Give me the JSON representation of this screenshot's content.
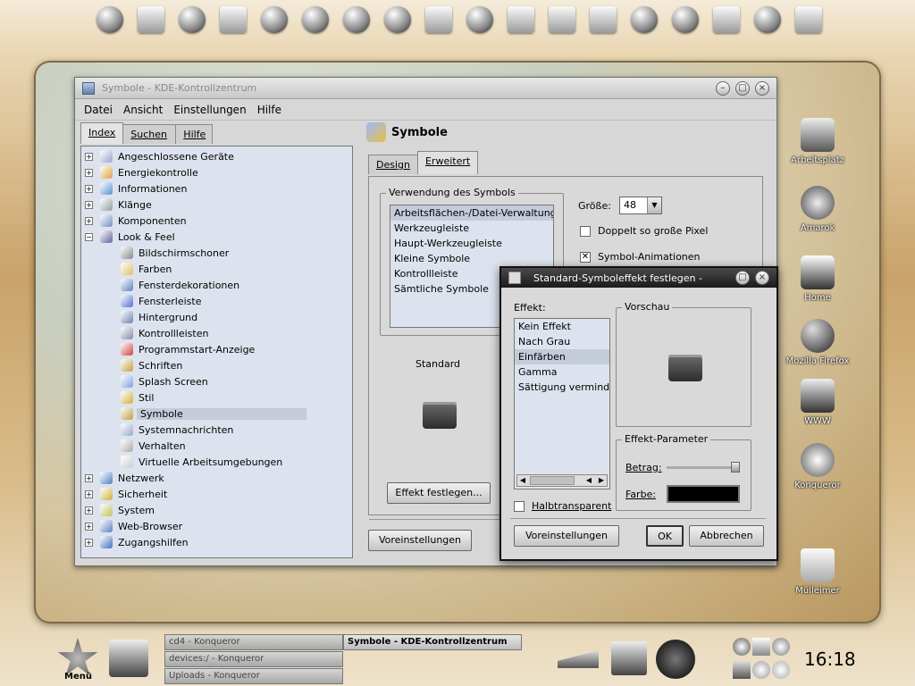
{
  "window": {
    "title": "Symbole - KDE-Kontrollzentrum",
    "menus": [
      "Datei",
      "Ansicht",
      "Einstellungen",
      "Hilfe"
    ]
  },
  "left_tabs": [
    "Index",
    "Suchen",
    "Hilfe"
  ],
  "tree": [
    {
      "label": "Angeschlossene Geräte",
      "expander": "+"
    },
    {
      "label": "Energiekontrolle",
      "expander": "+"
    },
    {
      "label": "Informationen",
      "expander": "+"
    },
    {
      "label": "Klänge",
      "expander": "+"
    },
    {
      "label": "Komponenten",
      "expander": "+"
    },
    {
      "label": "Look & Feel",
      "expander": "−"
    },
    {
      "label": "Bildschirmschoner",
      "child": true
    },
    {
      "label": "Farben",
      "child": true
    },
    {
      "label": "Fensterdekorationen",
      "child": true
    },
    {
      "label": "Fensterleiste",
      "child": true
    },
    {
      "label": "Hintergrund",
      "child": true
    },
    {
      "label": "Kontrollleisten",
      "child": true
    },
    {
      "label": "Programmstart-Anzeige",
      "child": true
    },
    {
      "label": "Schriften",
      "child": true
    },
    {
      "label": "Splash Screen",
      "child": true
    },
    {
      "label": "Stil",
      "child": true
    },
    {
      "label": "Symbole",
      "child": true,
      "selected": true
    },
    {
      "label": "Systemnachrichten",
      "child": true
    },
    {
      "label": "Verhalten",
      "child": true
    },
    {
      "label": "Virtuelle Arbeitsumgebungen",
      "child": true
    },
    {
      "label": "Netzwerk",
      "expander": "+"
    },
    {
      "label": "Sicherheit",
      "expander": "+"
    },
    {
      "label": "System",
      "expander": "+"
    },
    {
      "label": "Web-Browser",
      "expander": "+"
    },
    {
      "label": "Zugangshilfen",
      "expander": "+"
    }
  ],
  "panel": {
    "heading": "Symbole",
    "tabs": [
      "Design",
      "Erweitert"
    ],
    "usage_group": "Verwendung des Symbols",
    "usage_items": [
      "Arbeitsflächen-/Datei-Verwaltung",
      "Werkzeugleiste",
      "Haupt-Werkzeugleiste",
      "Kleine Symbole",
      "Kontrollleiste",
      "Sämtliche Symbole"
    ],
    "size_label": "Größe:",
    "size_value": "48",
    "double_label": "Doppelt so große Pixel",
    "anim_label": "Symbol-Animationen",
    "standard_label": "Standard",
    "effect_button": "Effekt festlegen...",
    "defaults_button": "Voreinstellungen"
  },
  "dialog": {
    "title": "Standard-Symboleffekt festlegen -",
    "effect_label": "Effekt:",
    "effects": [
      "Kein Effekt",
      "Nach Grau",
      "Einfärben",
      "Gamma",
      "Sättigung verminde"
    ],
    "preview_label": "Vorschau",
    "params_label": "Effekt-Parameter",
    "amount_label": "Betrag:",
    "color_label": "Farbe:",
    "semi_label": "Halbtransparent",
    "defaults_button": "Voreinstellungen",
    "ok_button": "OK",
    "cancel_button": "Abbrechen",
    "amount_value": 0.98,
    "color_value": "#000000"
  },
  "desktop_icons": [
    "Arbeitsplatz",
    "Amarok",
    "Home",
    "Mozilla Firefox",
    "WWW",
    "Konqueror",
    "Mülleimer"
  ],
  "taskbar": {
    "menu_label": "Menü",
    "tasks": [
      "cd4 - Konqueror",
      "devices:/ - Konqueror",
      "Uploads - Konqueror"
    ],
    "active_task": "Symbole - KDE-Kontrollzentrum",
    "clock": "16:18"
  }
}
